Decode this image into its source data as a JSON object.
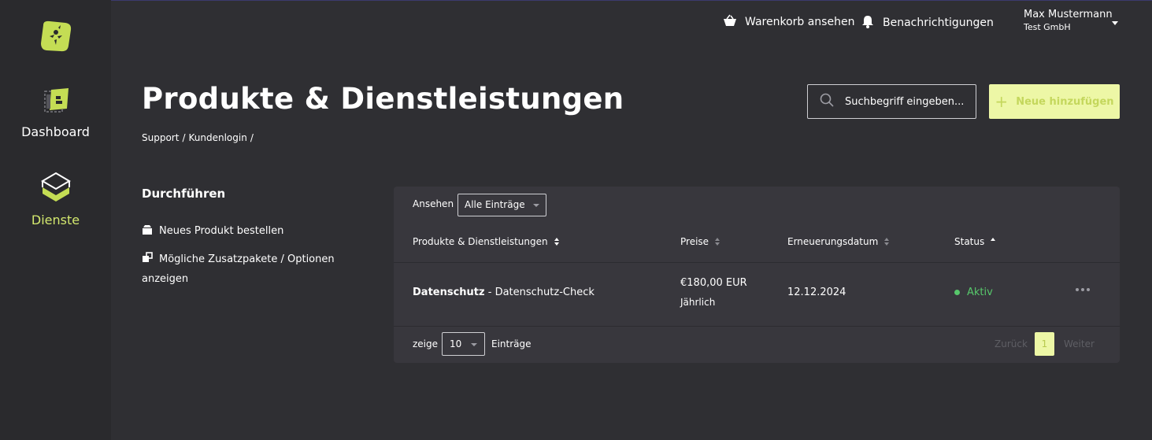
{
  "sidebar": {
    "logo": "app-logo",
    "items": [
      {
        "label": "Dashboard",
        "icon": "dashboard-icon"
      },
      {
        "label": "Dienste",
        "icon": "services-icon",
        "active": true
      }
    ]
  },
  "topbar": {
    "cart_label": "Warenkorb ansehen",
    "notifications_label": "Benachrichtigungen",
    "user_name": "Max Mustermann",
    "user_company": "Test GmbH"
  },
  "header": {
    "title": "Produkte & Dienstleistungen",
    "breadcrumb": [
      "Support",
      "Kundenlogin"
    ],
    "search_placeholder": "Suchbegriff eingeben...",
    "add_button_label": "Neue hinzufügen"
  },
  "actions": {
    "title": "Durchführen",
    "items": [
      {
        "label": "Neues Produkt bestellen",
        "icon": "box-icon"
      },
      {
        "label": "Mögliche Zusatzpakete / Optionen anzeigen",
        "icon": "addon-icon"
      }
    ]
  },
  "table": {
    "filter_label": "Ansehen",
    "filter_value": "Alle Einträge",
    "columns": [
      "Produkte & Dienstleistungen",
      "Preise",
      "Erneuerungsdatum",
      "Status"
    ],
    "rows": [
      {
        "product_group": "Datenschutz",
        "product_sep": " - ",
        "product_name": "Datenschutz-Check",
        "price": "€180,00 EUR",
        "cycle": "Jährlich",
        "renewal": "12.12.2024",
        "status": "Aktiv"
      }
    ],
    "footer": {
      "show_label": "zeige",
      "page_size": "10",
      "entries_label": "Einträge",
      "prev_label": "Zurück",
      "current_page": "1",
      "next_label": "Weiter"
    }
  },
  "colors": {
    "background": "#2f2f33",
    "sidebar": "#2a2a2d",
    "card": "#38373d",
    "accent": "#d3e86e",
    "accent_light": "#edf7a6",
    "status_active": "#57c76b"
  }
}
